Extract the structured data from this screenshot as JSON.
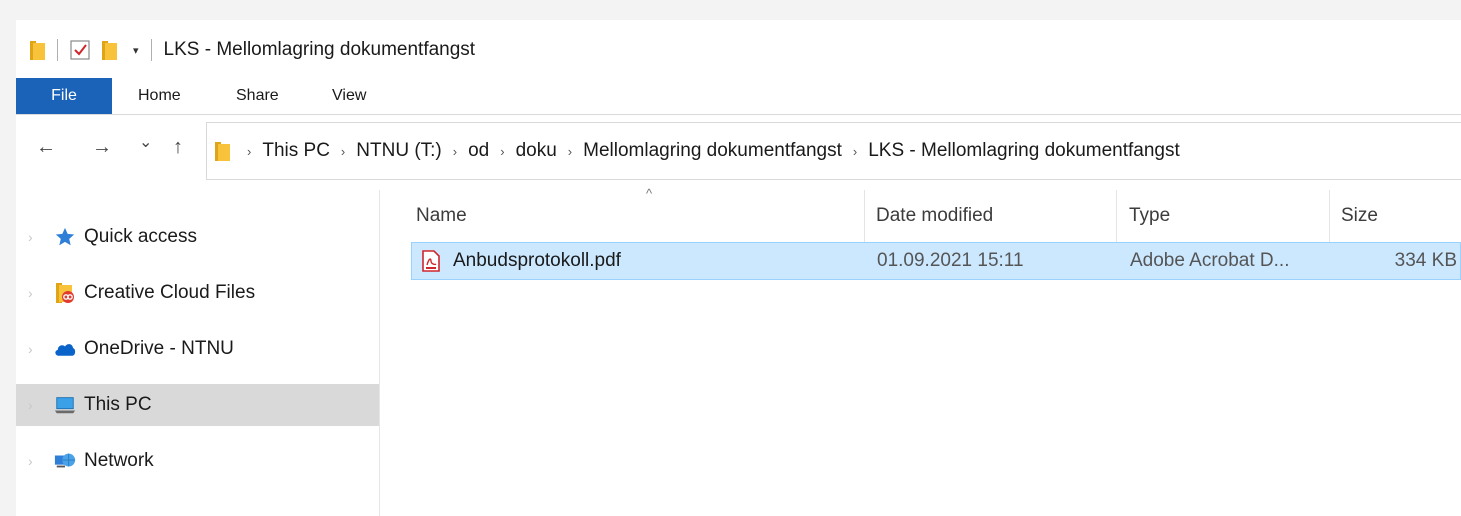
{
  "window": {
    "title": "LKS - Mellomlagring dokumentfangst",
    "quick_access_toolbar": {
      "dropdown_glyph": "▾"
    }
  },
  "ribbon": {
    "tabs": [
      {
        "label": "File"
      },
      {
        "label": "Home"
      },
      {
        "label": "Share"
      },
      {
        "label": "View"
      }
    ]
  },
  "navigation": {
    "back_glyph": "←",
    "forward_glyph": "→",
    "recent_glyph": "⌄",
    "up_glyph": "↑"
  },
  "address_bar": {
    "separator": "›",
    "crumbs": [
      "This PC",
      "NTNU (T:)",
      "od",
      "doku",
      "Mellomlagring dokumentfangst",
      "LKS - Mellomlagring dokumentfangst"
    ]
  },
  "sidebar": {
    "expand_glyph": "›",
    "items": [
      {
        "label": "Quick access",
        "icon": "star-icon",
        "selected": false
      },
      {
        "label": "Creative Cloud Files",
        "icon": "creative-cloud-folder-icon",
        "selected": false
      },
      {
        "label": "OneDrive - NTNU",
        "icon": "onedrive-cloud-icon",
        "selected": false
      },
      {
        "label": "This PC",
        "icon": "computer-icon",
        "selected": true
      },
      {
        "label": "Network",
        "icon": "network-icon",
        "selected": false
      }
    ]
  },
  "file_list": {
    "sort_glyph": "^",
    "columns": [
      {
        "label": "Name"
      },
      {
        "label": "Date modified"
      },
      {
        "label": "Type"
      },
      {
        "label": "Size"
      }
    ],
    "rows": [
      {
        "name": "Anbudsprotokoll.pdf",
        "date_modified": "01.09.2021 15:11",
        "type": "Adobe Acrobat D...",
        "size": "334 KB",
        "icon": "pdf-file-icon",
        "selected": true
      }
    ]
  },
  "colors": {
    "file_tab": "#1b63b8",
    "selection_fill": "#cce8ff",
    "selection_border": "#99d1ff",
    "sidebar_selected": "#d9d9d9",
    "folder_yellow": "#f8c23a",
    "pdf_red": "#d0262b"
  }
}
